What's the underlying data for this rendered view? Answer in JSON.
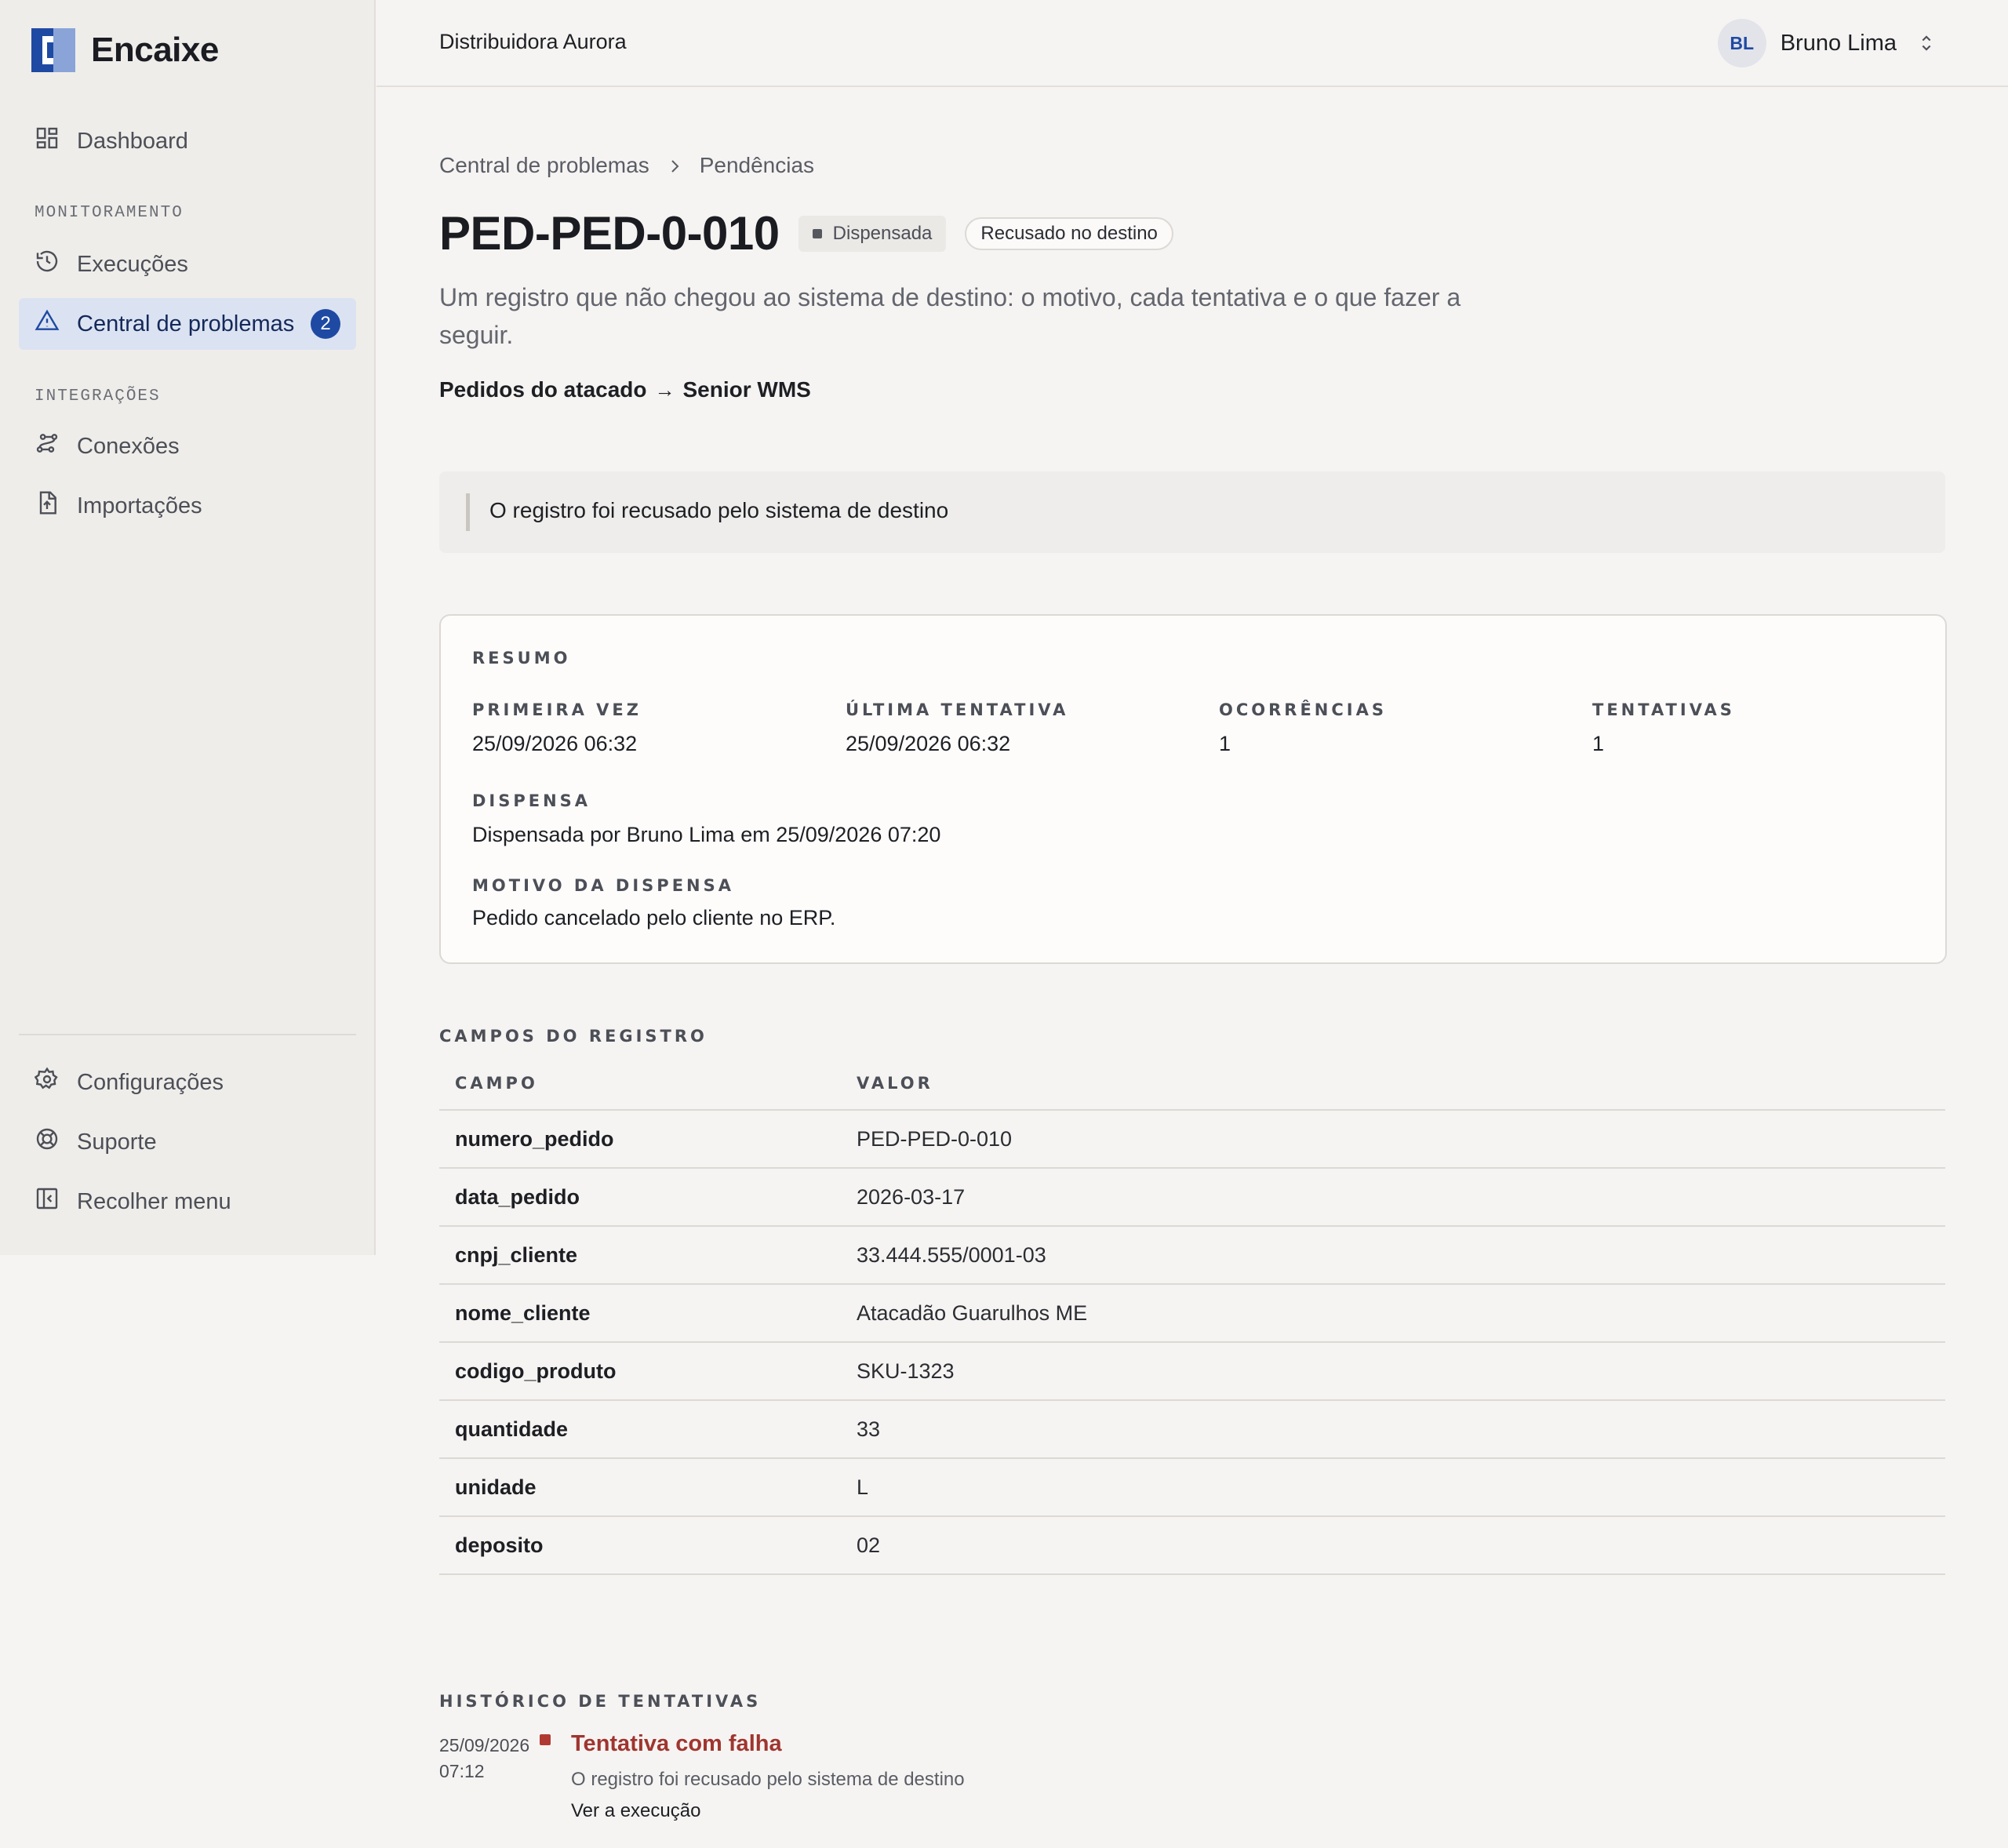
{
  "app": {
    "name": "Encaixe",
    "org": "Distribuidora Aurora",
    "user": {
      "initials": "BL",
      "name": "Bruno Lima"
    }
  },
  "sidebar": {
    "dashboard": "Dashboard",
    "section_monitoring": "MONITORAMENTO",
    "executions": "Execuções",
    "problems": "Central de problemas",
    "problems_count": "2",
    "section_integrations": "INTEGRAÇÕES",
    "connections": "Conexões",
    "imports": "Importações",
    "settings": "Configurações",
    "support": "Suporte",
    "collapse": "Recolher menu"
  },
  "breadcrumb": {
    "root": "Central de problemas",
    "current": "Pendências"
  },
  "header": {
    "title": "PED-PED-0-010",
    "status": "Dispensada",
    "reason": "Recusado no destino",
    "subtitle": "Um registro que não chegou ao sistema de destino: o motivo, cada tentativa e o que fazer a seguir.",
    "source": "Pedidos do atacado",
    "arrow": "→",
    "destination": "Senior WMS"
  },
  "alert": {
    "message": "O registro foi recusado pelo sistema de destino"
  },
  "summary": {
    "title": "RESUMO",
    "first_label": "PRIMEIRA VEZ",
    "first_value": "25/09/2026 06:32",
    "last_label": "ÚLTIMA TENTATIVA",
    "last_value": "25/09/2026 06:32",
    "occurrences_label": "OCORRÊNCIAS",
    "occurrences_value": "1",
    "attempts_label": "TENTATIVAS",
    "attempts_value": "1",
    "dismissal_label": "DISPENSA",
    "dismissal_value": "Dispensada por Bruno Lima em 25/09/2026 07:20",
    "dismissal_reason_label": "MOTIVO DA DISPENSA",
    "dismissal_reason_value": "Pedido cancelado pelo cliente no ERP."
  },
  "fields": {
    "title": "CAMPOS DO REGISTRO",
    "col_field": "CAMPO",
    "col_value": "VALOR",
    "rows": [
      {
        "key": "numero_pedido",
        "value": "PED-PED-0-010"
      },
      {
        "key": "data_pedido",
        "value": "2026-03-17"
      },
      {
        "key": "cnpj_cliente",
        "value": "33.444.555/0001-03"
      },
      {
        "key": "nome_cliente",
        "value": "Atacadão Guarulhos ME"
      },
      {
        "key": "codigo_produto",
        "value": "SKU-1323"
      },
      {
        "key": "quantidade",
        "value": "33"
      },
      {
        "key": "unidade",
        "value": "L"
      },
      {
        "key": "deposito",
        "value": "02"
      }
    ]
  },
  "history": {
    "title": "HISTÓRICO DE TENTATIVAS",
    "items": [
      {
        "date": "25/09/2026",
        "time": "07:12",
        "title": "Tentativa com falha",
        "description": "O registro foi recusado pelo sistema de destino",
        "link": "Ver a execução",
        "status_color": "#b03a33"
      }
    ]
  },
  "colors": {
    "accent": "#1f4aa3",
    "active_bg": "#dbe3f2",
    "error": "#9f3530"
  }
}
